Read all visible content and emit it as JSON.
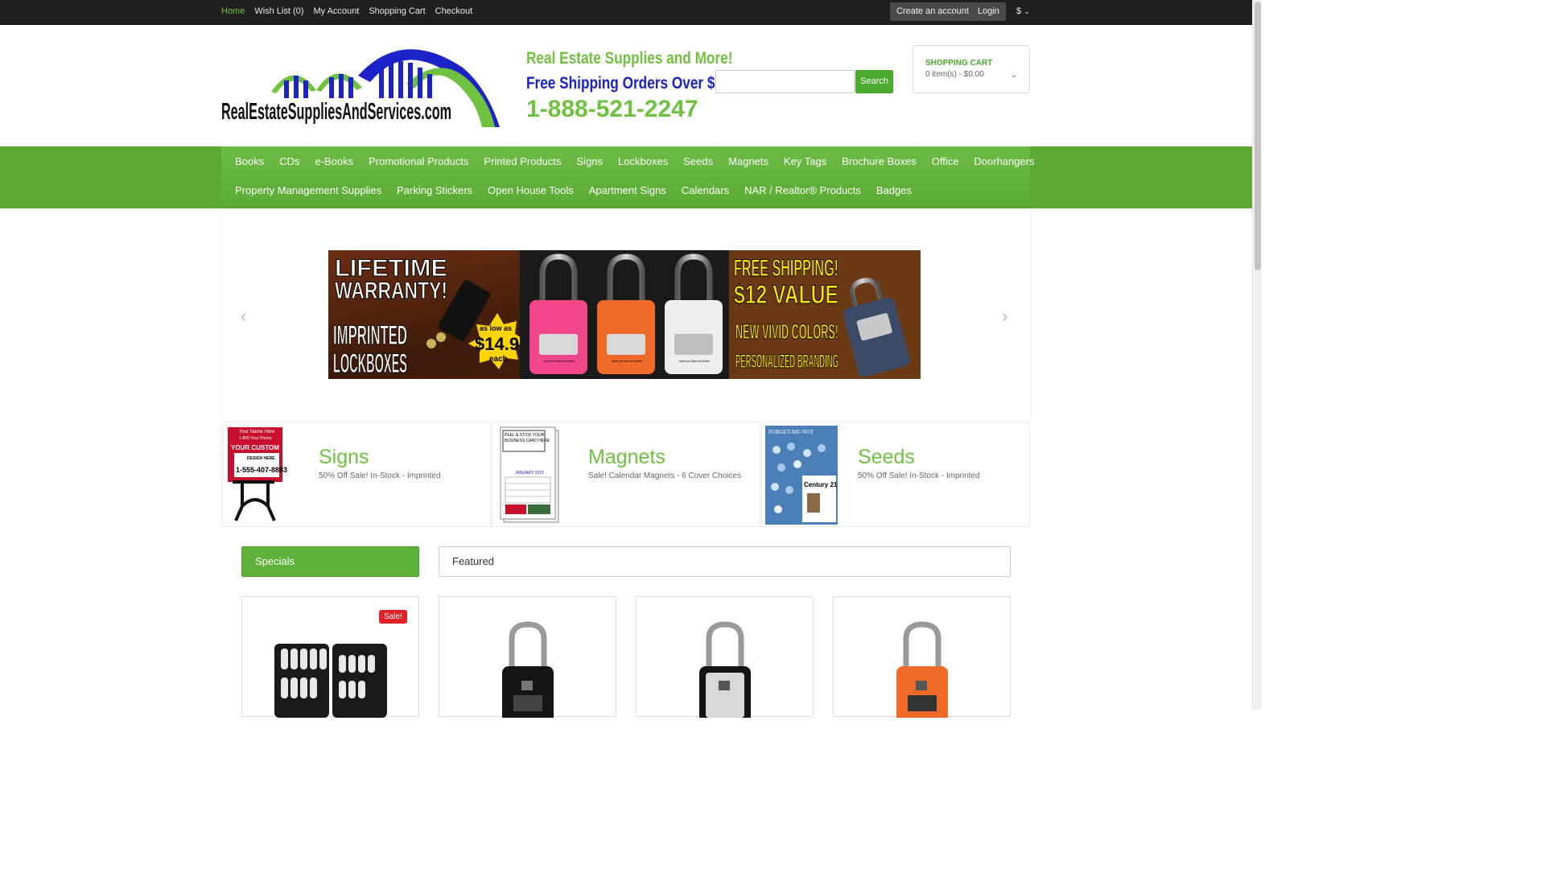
{
  "topbar": {
    "links": [
      "Home",
      "Wish List (0)",
      "My Account",
      "Shopping Cart",
      "Checkout"
    ],
    "create_account": "Create an account",
    "login": "Login",
    "currency": "$"
  },
  "header": {
    "logo_text": "RealEstateSuppliesAndServices.com",
    "tagline1": "Real Estate Supplies and More!",
    "tagline2": "Free Shipping Orders Over $99",
    "phone": "1-888-521-2247",
    "search_button": "Search",
    "search_placeholder": "",
    "cart_title": "SHOPPING CART",
    "cart_summary": "0 item(s) - $0.00"
  },
  "nav": {
    "row1": [
      "Books",
      "CDs",
      "e-Books",
      "Promotional Products",
      "Printed Products",
      "Signs",
      "Lockboxes",
      "Seeds",
      "Magnets",
      "Key Tags",
      "Brochure Boxes",
      "Office",
      "Doorhangers"
    ],
    "row2": [
      "Property Management Supplies",
      "Parking Stickers",
      "Open House Tools",
      "Apartment Signs",
      "Calendars",
      "NAR / Realtor® Products",
      "Badges"
    ]
  },
  "banner": {
    "left_line1": "LIFETIME",
    "left_line2": "WARRANTY!",
    "left_line3": "IMPRINTED",
    "left_line4": "LOCKBOXES",
    "price_line1": "as low as",
    "price_line2": "$14.97",
    "price_line3": "each",
    "right_line1": "FREE SHIPPING!",
    "right_line2": "$12 VALUE",
    "right_line3": "NEW VIVID COLORS!",
    "right_line4": "PERSONALIZED BRANDING",
    "lockbox_caption": "Imprint your Name and Number"
  },
  "promos": [
    {
      "title": "Signs",
      "subtitle": "50% Off Sale! In-Stock - Imprinted",
      "img_text1": "Your Name Here",
      "img_text2": "1-800-Your Phone",
      "img_text3": "YOUR CUSTOM",
      "img_text4": "DESIGN HERE",
      "img_text5": "1-555-407-8883"
    },
    {
      "title": "Magnets",
      "subtitle": "Sale! Calendar Magnets - 6 Cover Choices",
      "img_text1": "PEEL & STICK YOUR",
      "img_text2": "BUSINESS CARD HERE",
      "img_text3": "JANUARY 2015"
    },
    {
      "title": "Seeds",
      "subtitle": "50% Off Sale! In-Stock - Imprinted",
      "img_text1": "FORGET-ME-NOT",
      "img_text2": "Century 21"
    }
  ],
  "tabs": {
    "specials": "Specials",
    "featured": "Featured"
  },
  "products": {
    "sale_badge": "Sale!"
  },
  "colors": {
    "brand_green": "#6fc23f",
    "brand_blue": "#1a22c8",
    "sale_red": "#e42027"
  }
}
